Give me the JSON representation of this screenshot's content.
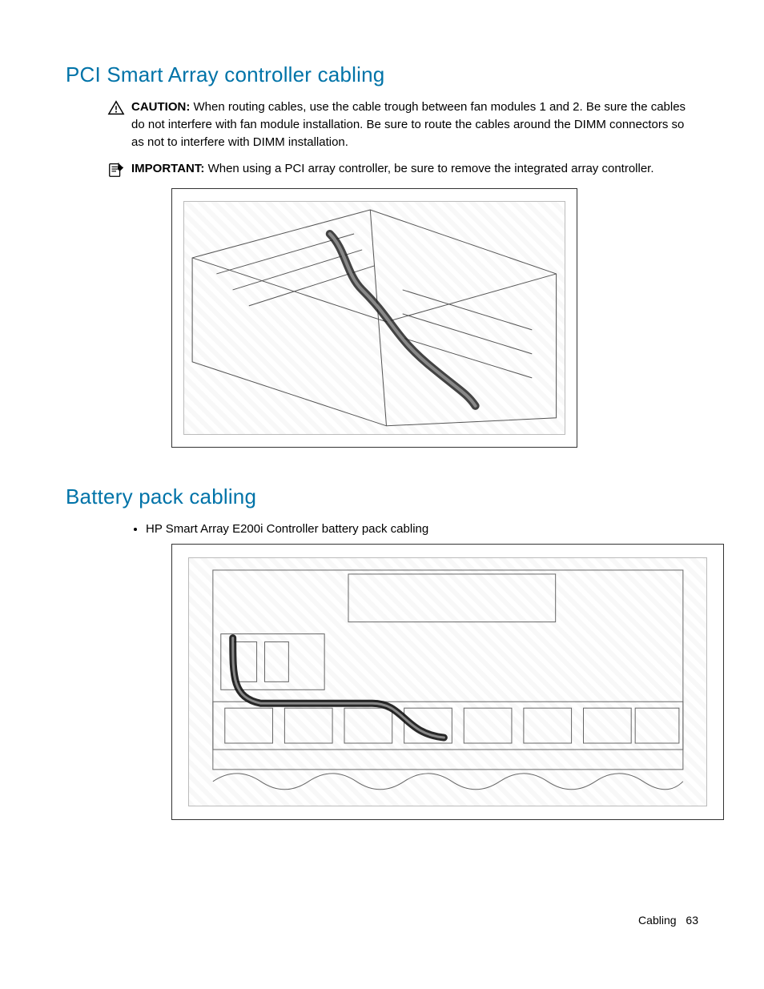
{
  "section1": {
    "title": "PCI Smart Array controller cabling",
    "caution_label": "CAUTION:",
    "caution_text": "When routing cables, use the cable trough between fan modules 1 and 2. Be sure the cables do not interfere with fan module installation. Be sure to route the cables around the DIMM connectors so as not to interfere with DIMM installation.",
    "important_label": "IMPORTANT:",
    "important_text": "When using a PCI array controller, be sure to remove the integrated array controller."
  },
  "section2": {
    "title": "Battery pack cabling",
    "bullet1": "HP Smart Array E200i Controller battery pack cabling"
  },
  "icons": {
    "caution": "caution-triangle-icon",
    "important": "note-pencil-icon"
  },
  "figures": {
    "fig1_alt": "Isometric technical line drawing of server chassis interior showing a flat ribbon cable routed from a PCI Smart Array controller through the cable trough between fan modules.",
    "fig2_alt": "Top-down technical line drawing of server chassis showing battery pack cable routed from controller across fan bay area."
  },
  "footer": {
    "section": "Cabling",
    "page": "63"
  }
}
